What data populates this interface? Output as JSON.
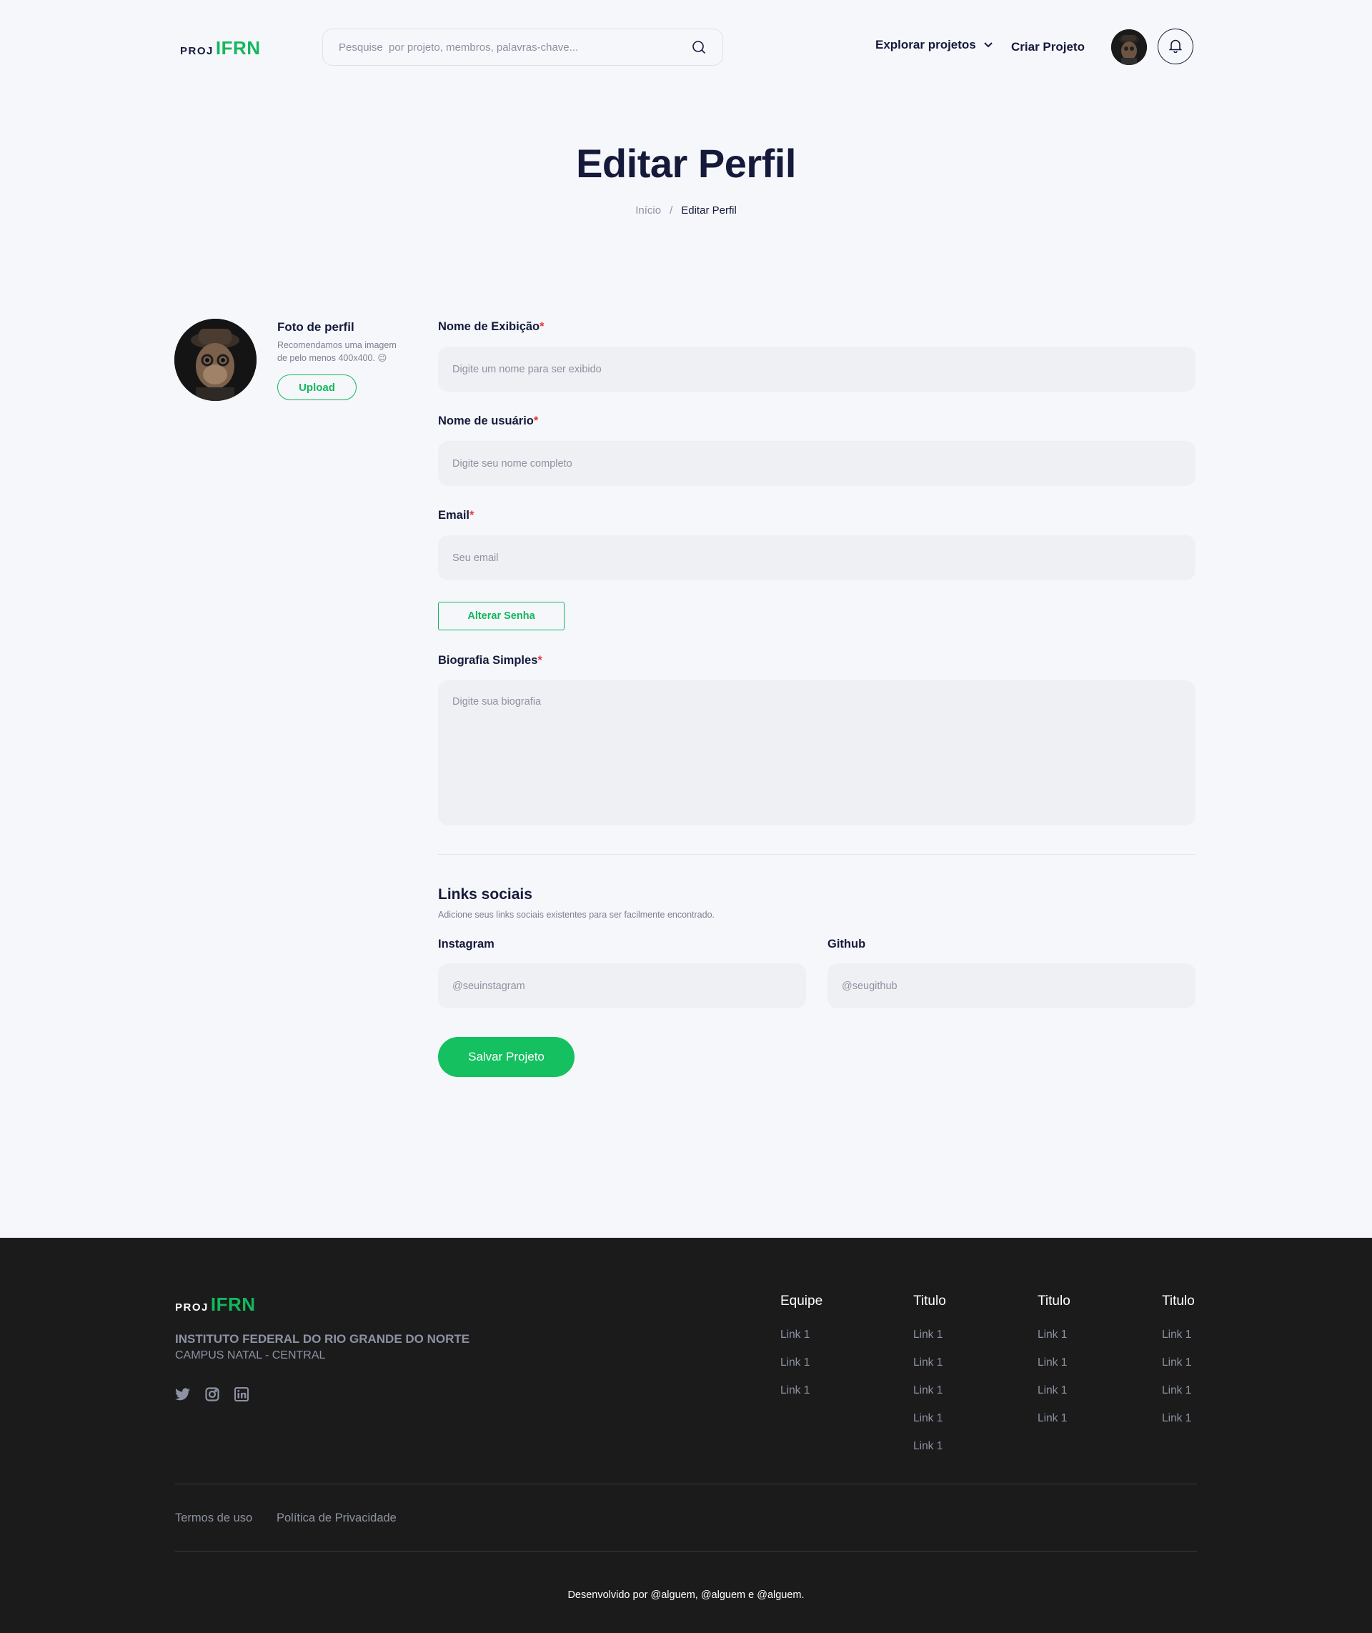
{
  "header": {
    "logo_proj": "PROJ",
    "logo_ifrn": "IFRN",
    "search_placeholder": "Pesquise  por projeto, membros, palavras-chave...",
    "nav_explore": "Explorar projetos",
    "nav_create": "Criar Projeto"
  },
  "page": {
    "title": "Editar Perfil",
    "breadcrumb": {
      "home": "Início",
      "separator": "/",
      "current": "Editar Perfil"
    }
  },
  "profile_photo": {
    "title": "Foto de perfil",
    "description": "Recomendamos uma imagem de pelo menos 400x400. 😉",
    "upload_label": "Upload"
  },
  "form": {
    "display_name": {
      "label": "Nome de Exibição",
      "required_mark": "*",
      "placeholder": "Digite um nome para ser exibido"
    },
    "username": {
      "label": "Nome de usuário",
      "required_mark": "*",
      "placeholder": "Digite seu nome completo"
    },
    "email": {
      "label": "Email",
      "required_mark": "*",
      "placeholder": "Seu email"
    },
    "change_password_label": "Alterar Senha",
    "bio": {
      "label": "Biografia Simples",
      "required_mark": "*",
      "placeholder": "Digite sua biografia"
    }
  },
  "social": {
    "title": "Links sociais",
    "description": "Adicione seus links sociais existentes para ser facilmente encontrado.",
    "instagram": {
      "label": "Instagram",
      "placeholder": "@seuinstagram"
    },
    "github": {
      "label": "Github",
      "placeholder": "@seugithub"
    }
  },
  "save_label": "Salvar Projeto",
  "footer": {
    "logo_proj": "PROJ",
    "logo_ifrn": "IFRN",
    "institute": "INSTITUTO FEDERAL DO RIO GRANDE DO NORTE",
    "campus": "CAMPUS NATAL - CENTRAL",
    "social_icons": [
      "twitter-icon",
      "instagram-icon",
      "linkedin-icon"
    ],
    "columns": [
      {
        "title": "Equipe",
        "links": [
          "Link 1",
          "Link 1",
          "Link 1"
        ]
      },
      {
        "title": "Titulo",
        "links": [
          "Link 1",
          "Link 1",
          "Link 1",
          "Link 1",
          "Link 1"
        ]
      },
      {
        "title": "Titulo",
        "links": [
          "Link 1",
          "Link 1",
          "Link 1",
          "Link 1"
        ]
      },
      {
        "title": "Titulo",
        "links": [
          "Link 1",
          "Link 1",
          "Link 1",
          "Link 1"
        ]
      }
    ],
    "terms": "Termos de uso",
    "privacy": "Política de Privacidade",
    "credits": "Desenvolvido por @alguem, @alguem e @alguem."
  },
  "colors": {
    "accent": "#14b75d",
    "text_dark": "#151a3a",
    "background": "#f6f7fb",
    "footer_bg": "#1b1b1c",
    "required": "#e5393d"
  }
}
